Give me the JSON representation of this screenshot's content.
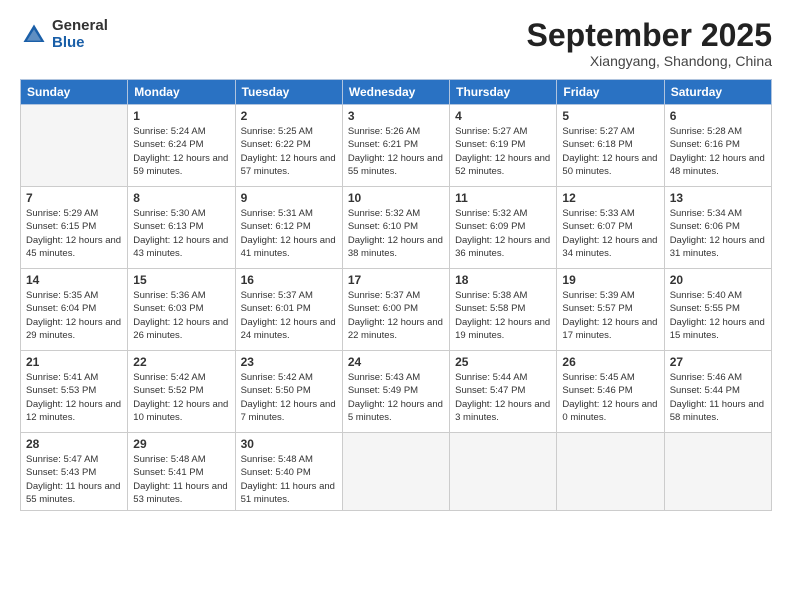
{
  "logo": {
    "general": "General",
    "blue": "Blue"
  },
  "title": "September 2025",
  "subtitle": "Xiangyang, Shandong, China",
  "days_of_week": [
    "Sunday",
    "Monday",
    "Tuesday",
    "Wednesday",
    "Thursday",
    "Friday",
    "Saturday"
  ],
  "weeks": [
    [
      {
        "day": null
      },
      {
        "day": 1,
        "sunrise": "Sunrise: 5:24 AM",
        "sunset": "Sunset: 6:24 PM",
        "daylight": "Daylight: 12 hours and 59 minutes."
      },
      {
        "day": 2,
        "sunrise": "Sunrise: 5:25 AM",
        "sunset": "Sunset: 6:22 PM",
        "daylight": "Daylight: 12 hours and 57 minutes."
      },
      {
        "day": 3,
        "sunrise": "Sunrise: 5:26 AM",
        "sunset": "Sunset: 6:21 PM",
        "daylight": "Daylight: 12 hours and 55 minutes."
      },
      {
        "day": 4,
        "sunrise": "Sunrise: 5:27 AM",
        "sunset": "Sunset: 6:19 PM",
        "daylight": "Daylight: 12 hours and 52 minutes."
      },
      {
        "day": 5,
        "sunrise": "Sunrise: 5:27 AM",
        "sunset": "Sunset: 6:18 PM",
        "daylight": "Daylight: 12 hours and 50 minutes."
      },
      {
        "day": 6,
        "sunrise": "Sunrise: 5:28 AM",
        "sunset": "Sunset: 6:16 PM",
        "daylight": "Daylight: 12 hours and 48 minutes."
      }
    ],
    [
      {
        "day": 7,
        "sunrise": "Sunrise: 5:29 AM",
        "sunset": "Sunset: 6:15 PM",
        "daylight": "Daylight: 12 hours and 45 minutes."
      },
      {
        "day": 8,
        "sunrise": "Sunrise: 5:30 AM",
        "sunset": "Sunset: 6:13 PM",
        "daylight": "Daylight: 12 hours and 43 minutes."
      },
      {
        "day": 9,
        "sunrise": "Sunrise: 5:31 AM",
        "sunset": "Sunset: 6:12 PM",
        "daylight": "Daylight: 12 hours and 41 minutes."
      },
      {
        "day": 10,
        "sunrise": "Sunrise: 5:32 AM",
        "sunset": "Sunset: 6:10 PM",
        "daylight": "Daylight: 12 hours and 38 minutes."
      },
      {
        "day": 11,
        "sunrise": "Sunrise: 5:32 AM",
        "sunset": "Sunset: 6:09 PM",
        "daylight": "Daylight: 12 hours and 36 minutes."
      },
      {
        "day": 12,
        "sunrise": "Sunrise: 5:33 AM",
        "sunset": "Sunset: 6:07 PM",
        "daylight": "Daylight: 12 hours and 34 minutes."
      },
      {
        "day": 13,
        "sunrise": "Sunrise: 5:34 AM",
        "sunset": "Sunset: 6:06 PM",
        "daylight": "Daylight: 12 hours and 31 minutes."
      }
    ],
    [
      {
        "day": 14,
        "sunrise": "Sunrise: 5:35 AM",
        "sunset": "Sunset: 6:04 PM",
        "daylight": "Daylight: 12 hours and 29 minutes."
      },
      {
        "day": 15,
        "sunrise": "Sunrise: 5:36 AM",
        "sunset": "Sunset: 6:03 PM",
        "daylight": "Daylight: 12 hours and 26 minutes."
      },
      {
        "day": 16,
        "sunrise": "Sunrise: 5:37 AM",
        "sunset": "Sunset: 6:01 PM",
        "daylight": "Daylight: 12 hours and 24 minutes."
      },
      {
        "day": 17,
        "sunrise": "Sunrise: 5:37 AM",
        "sunset": "Sunset: 6:00 PM",
        "daylight": "Daylight: 12 hours and 22 minutes."
      },
      {
        "day": 18,
        "sunrise": "Sunrise: 5:38 AM",
        "sunset": "Sunset: 5:58 PM",
        "daylight": "Daylight: 12 hours and 19 minutes."
      },
      {
        "day": 19,
        "sunrise": "Sunrise: 5:39 AM",
        "sunset": "Sunset: 5:57 PM",
        "daylight": "Daylight: 12 hours and 17 minutes."
      },
      {
        "day": 20,
        "sunrise": "Sunrise: 5:40 AM",
        "sunset": "Sunset: 5:55 PM",
        "daylight": "Daylight: 12 hours and 15 minutes."
      }
    ],
    [
      {
        "day": 21,
        "sunrise": "Sunrise: 5:41 AM",
        "sunset": "Sunset: 5:53 PM",
        "daylight": "Daylight: 12 hours and 12 minutes."
      },
      {
        "day": 22,
        "sunrise": "Sunrise: 5:42 AM",
        "sunset": "Sunset: 5:52 PM",
        "daylight": "Daylight: 12 hours and 10 minutes."
      },
      {
        "day": 23,
        "sunrise": "Sunrise: 5:42 AM",
        "sunset": "Sunset: 5:50 PM",
        "daylight": "Daylight: 12 hours and 7 minutes."
      },
      {
        "day": 24,
        "sunrise": "Sunrise: 5:43 AM",
        "sunset": "Sunset: 5:49 PM",
        "daylight": "Daylight: 12 hours and 5 minutes."
      },
      {
        "day": 25,
        "sunrise": "Sunrise: 5:44 AM",
        "sunset": "Sunset: 5:47 PM",
        "daylight": "Daylight: 12 hours and 3 minutes."
      },
      {
        "day": 26,
        "sunrise": "Sunrise: 5:45 AM",
        "sunset": "Sunset: 5:46 PM",
        "daylight": "Daylight: 12 hours and 0 minutes."
      },
      {
        "day": 27,
        "sunrise": "Sunrise: 5:46 AM",
        "sunset": "Sunset: 5:44 PM",
        "daylight": "Daylight: 11 hours and 58 minutes."
      }
    ],
    [
      {
        "day": 28,
        "sunrise": "Sunrise: 5:47 AM",
        "sunset": "Sunset: 5:43 PM",
        "daylight": "Daylight: 11 hours and 55 minutes."
      },
      {
        "day": 29,
        "sunrise": "Sunrise: 5:48 AM",
        "sunset": "Sunset: 5:41 PM",
        "daylight": "Daylight: 11 hours and 53 minutes."
      },
      {
        "day": 30,
        "sunrise": "Sunrise: 5:48 AM",
        "sunset": "Sunset: 5:40 PM",
        "daylight": "Daylight: 11 hours and 51 minutes."
      },
      {
        "day": null
      },
      {
        "day": null
      },
      {
        "day": null
      },
      {
        "day": null
      }
    ]
  ]
}
